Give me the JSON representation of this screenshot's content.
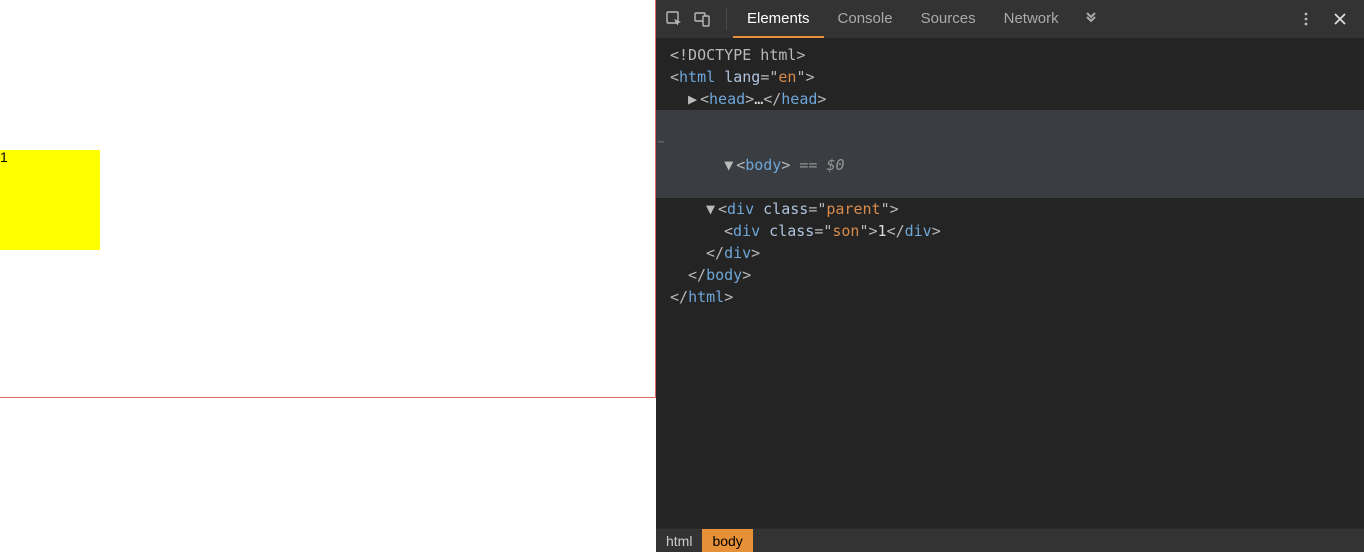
{
  "rendered": {
    "son_text": "1"
  },
  "devtools": {
    "tabs": {
      "elements": "Elements",
      "console": "Console",
      "sources": "Sources",
      "network": "Network"
    },
    "dom": {
      "doctype": "<!DOCTYPE html>",
      "html_open_1": "<",
      "html_tag": "html",
      "html_attr_name": "lang",
      "html_attr_val": "en",
      "html_open_2": ">",
      "head_open": "<",
      "head_tag": "head",
      "head_gt": ">",
      "head_ellipsis": "…",
      "head_close_open": "</",
      "head_close_tag": "head",
      "head_close_gt": ">",
      "body_open": "<",
      "body_tag": "body",
      "body_gt": ">",
      "eq0": " == $0",
      "div1_open": "<",
      "div1_tag": "div",
      "div1_attr_name": "class",
      "div1_attr_val": "parent",
      "div1_gt": ">",
      "div2_open": "<",
      "div2_tag": "div",
      "div2_attr_name": "class",
      "div2_attr_val": "son",
      "div2_gt": ">",
      "div2_text": "1",
      "div2_close_open": "</",
      "div2_close_tag": "div",
      "div2_close_gt": ">",
      "div1_close_open": "</",
      "div1_close_tag": "div",
      "div1_close_gt": ">",
      "body_close_open": "</",
      "body_close_tag": "body",
      "body_close_gt": ">",
      "html_close_open": "</",
      "html_close_tag": "html",
      "html_close_gt": ">"
    },
    "breadcrumb": {
      "html": "html",
      "body": "body"
    }
  }
}
